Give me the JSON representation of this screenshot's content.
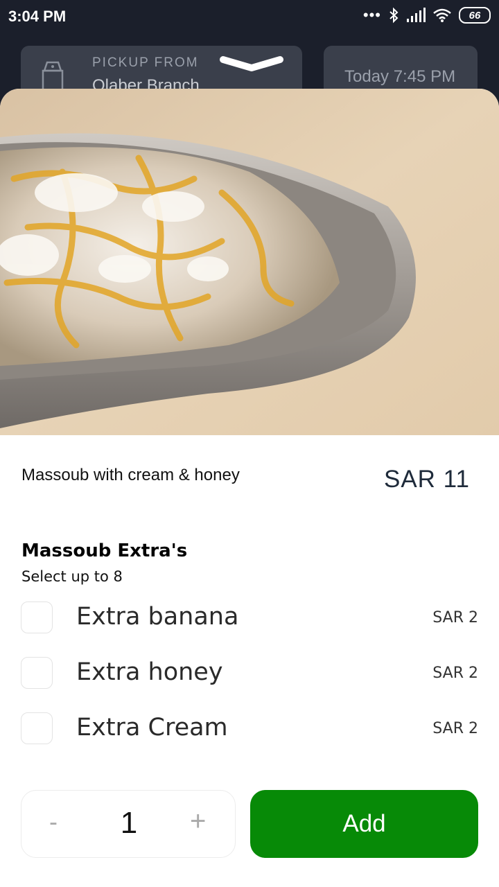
{
  "status_bar": {
    "time": "3:04 PM",
    "dots": "•••",
    "battery": "66",
    "icons": [
      "bluetooth-icon",
      "signal-icon",
      "wifi-icon",
      "battery-icon"
    ]
  },
  "header": {
    "pickup_label": "PICKUP FROM",
    "branch": "Olaber Branch",
    "pickup_time": "Today 7:45 PM"
  },
  "item": {
    "name": "Massoub with cream & honey",
    "price": "SAR 11"
  },
  "extras": {
    "title": "Massoub Extra's",
    "subtitle": "Select up to 8",
    "options": [
      {
        "label": "Extra banana",
        "price": "SAR 2",
        "checked": false
      },
      {
        "label": "Extra honey",
        "price": "SAR 2",
        "checked": false
      },
      {
        "label": "Extra Cream",
        "price": "SAR 2",
        "checked": false
      }
    ]
  },
  "quantity": {
    "minus": "-",
    "value": "1",
    "plus": "+"
  },
  "add_button": "Add",
  "colors": {
    "accent": "#078a07",
    "background": "#1b1f2b",
    "header_card": "#3a3f4b"
  }
}
